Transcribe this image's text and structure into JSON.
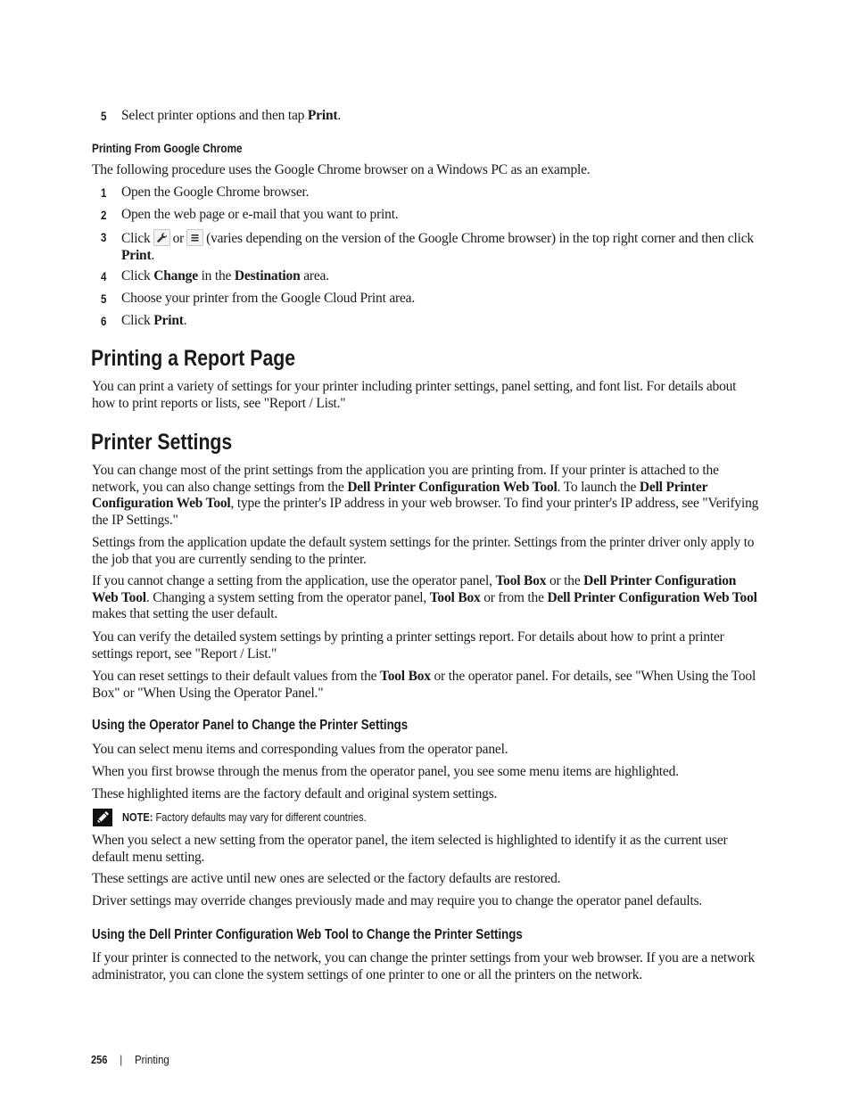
{
  "top_steps": [
    {
      "num": "5",
      "pre": "Select printer options and then tap ",
      "bold": "Print",
      "post": "."
    }
  ],
  "chrome_section": {
    "heading": "Printing From Google Chrome",
    "intro": "The following procedure uses the Google Chrome browser on a Windows PC as an example.",
    "steps": [
      {
        "num": "1",
        "text": "Open the Google Chrome browser."
      },
      {
        "num": "2",
        "text": "Open the web page or e-mail that you want to print."
      },
      {
        "num": "3",
        "pre": "Click",
        "or": "or",
        "post": "(varies depending on the version of the Google Chrome browser) in the top right corner and then click ",
        "bold": "Print",
        "end": ".",
        "icons": [
          "wrench-icon",
          "menu-icon"
        ]
      },
      {
        "num": "4",
        "pre": "Click ",
        "bold1": "Change",
        "mid": " in the ",
        "bold2": "Destination",
        "post": " area."
      },
      {
        "num": "5",
        "text": "Choose your printer from the Google Cloud Print area."
      },
      {
        "num": "6",
        "pre": "Click ",
        "bold": "Print",
        "post": "."
      }
    ]
  },
  "report_section": {
    "heading": "Printing a Report Page",
    "body": "You can print a variety of settings for your printer including printer settings, panel setting, and font list. For details about how to print reports or lists, see \"Report / List.\""
  },
  "printer_settings": {
    "heading": "Printer Settings",
    "p1": {
      "a": "You can change most of the print settings from the application you are printing from. If your printer is attached to the network, you can also change settings from the ",
      "b1": "Dell Printer Configuration Web Tool",
      "c": ". To launch the ",
      "b2": "Dell Printer Configuration Web Tool",
      "d": ", type the printer's IP address in your web browser. To find your printer's IP address, see \"Verifying the IP Settings.\""
    },
    "p2": "Settings from the application update the default system settings for the printer. Settings from the printer driver only apply to the job that you are currently sending to the printer.",
    "p3": {
      "a": "If you cannot change a setting from the application, use the operator panel, ",
      "b1": "Tool Box",
      "c": " or the ",
      "b2": "Dell Printer Configuration Web Tool",
      "d": ". Changing a system setting from the operator panel, ",
      "b3": "Tool Box",
      "e": " or from the ",
      "b4": "Dell Printer Configuration Web Tool",
      "f": " makes that setting the user default."
    },
    "p4": "You can verify the detailed system settings by printing a printer settings report. For details about how to print a printer settings report, see \"Report / List.\"",
    "p5": {
      "a": "You can reset settings to their default values from the ",
      "b1": "Tool Box",
      "c": " or the operator panel. For details, see \"When Using the Tool Box\" or \"When Using the Operator Panel.\""
    }
  },
  "operator_panel_section": {
    "heading": "Using the Operator Panel to Change the Printer Settings",
    "p1": "You can select menu items and corresponding values from the operator panel.",
    "p2": "When you first browse through the menus from the operator panel, you see some menu items are highlighted.",
    "p3": "These highlighted items are the factory default and original system settings.",
    "note_label": "NOTE:",
    "note_text": " Factory defaults may vary for different countries.",
    "p4": "When you select a new setting from the operator panel, the item selected is highlighted to identify it as the current user default menu setting.",
    "p5": "These settings are active until new ones are selected or the factory defaults are restored.",
    "p6": "Driver settings may override changes previously made and may require you to change the operator panel defaults."
  },
  "web_tool_section": {
    "heading": "Using the Dell Printer Configuration Web Tool to Change the Printer Settings",
    "p1": "If your printer is connected to the network, you can change the printer settings from your web browser. If you are a network administrator, you can clone the system settings of one printer to one or all the printers on the network."
  },
  "footer": {
    "page_number": "256",
    "separator": "|",
    "section": "Printing"
  }
}
